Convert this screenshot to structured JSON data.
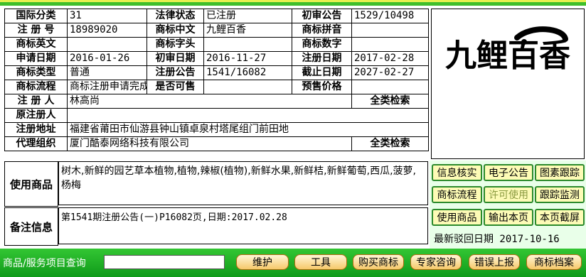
{
  "fields": {
    "intl_class_label": "国际分类",
    "intl_class": "31",
    "legal_status_label": "法律状态",
    "legal_status": "已注册",
    "prelim_notice_label": "初审公告",
    "prelim_notice": "1529/10498",
    "reg_no_label": "注 册 号",
    "reg_no": "18989020",
    "tm_cn_label": "商标中文",
    "tm_cn": "九鲤百香",
    "tm_pinyin_label": "商标拼音",
    "tm_pinyin": "",
    "tm_en_label": "商标英文",
    "tm_en": "",
    "tm_letter_label": "商标字头",
    "tm_letter": "",
    "tm_digit_label": "商标数字",
    "tm_digit": "",
    "apply_date_label": "申请日期",
    "apply_date": "2016-01-26",
    "prelim_date_label": "初审日期",
    "prelim_date": "2016-11-27",
    "reg_date_label": "注册日期",
    "reg_date": "2017-02-28",
    "tm_type_label": "商标类型",
    "tm_type": "普通",
    "reg_notice_label": "注册公告",
    "reg_notice": "1541/16082",
    "expire_date_label": "截止日期",
    "expire_date": "2027-02-27",
    "process_label": "商标流程",
    "process": "商标注册申请完成",
    "for_sale_label": "是否可售",
    "for_sale": "",
    "presale_price_label": "预售价格",
    "presale_price": "",
    "registrant_label": "注 册 人",
    "registrant": "林高尚",
    "search_all_1": "全类检索",
    "orig_registrant_label": "原注册人",
    "orig_registrant": "",
    "reg_address_label": "注册地址",
    "reg_address": "福建省莆田市仙游县钟山镇卓泉村塔尾组门前田地",
    "agency_label": "代理组织",
    "agency": "厦门酷泰网络科技有限公司",
    "search_all_2": "全类检索"
  },
  "logo_text": "九鲤百香",
  "goods": {
    "label": "使用商品",
    "text": "树木,新鲜的园艺草本植物,植物,辣椒(植物),新鲜水果,新鲜桔,新鲜葡萄,西瓜,菠萝,杨梅"
  },
  "remark": {
    "label": "备注信息",
    "text": "第1541期注册公告(一)P16082页,日期:2017.02.28"
  },
  "side_buttons": [
    "信息核实",
    "电子公告",
    "图素跟踪",
    "商标流程",
    "许可使用",
    "跟踪监测",
    "使用商品",
    "输出本页",
    "本页截屏"
  ],
  "last_reject": "最新驳回日期 2017-10-16",
  "bottom": {
    "query_label": "商品/服务项目查询",
    "query_value": "",
    "buttons": [
      "维护",
      "工具",
      "购买商标",
      "专家咨询",
      "错误上报",
      "商标档案"
    ]
  }
}
